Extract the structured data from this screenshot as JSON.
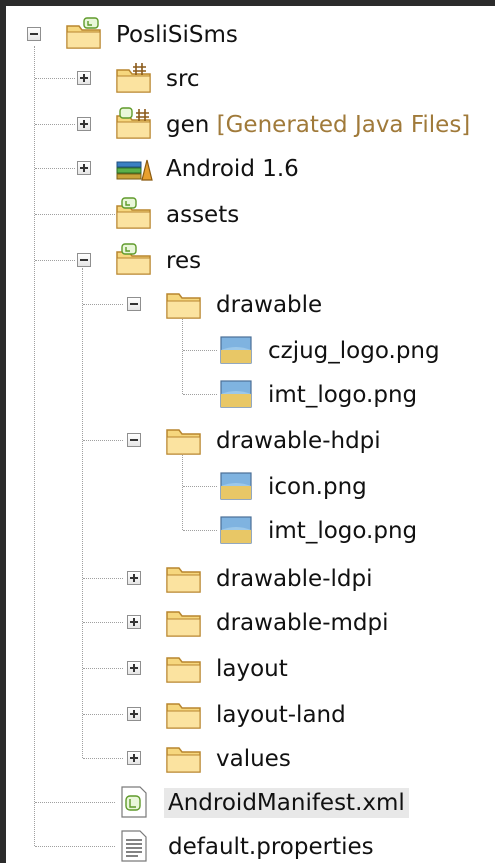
{
  "tree": {
    "project": {
      "label": "PosliSiSms",
      "icon": "android-project-folder-icon"
    },
    "src": {
      "label": "src",
      "icon": "source-folder-icon"
    },
    "gen": {
      "label": "gen",
      "decoration": "[Generated Java Files]",
      "icon": "generated-source-folder-icon"
    },
    "android": {
      "label": "Android 1.6",
      "icon": "android-library-icon"
    },
    "assets": {
      "label": "assets",
      "icon": "android-folder-icon"
    },
    "res": {
      "label": "res",
      "icon": "android-folder-icon"
    },
    "drawable": {
      "label": "drawable",
      "icon": "folder-icon"
    },
    "drawable_czjug": {
      "label": "czjug_logo.png",
      "icon": "image-file-icon"
    },
    "drawable_imt": {
      "label": "imt_logo.png",
      "icon": "image-file-icon"
    },
    "drawable_hdpi": {
      "label": "drawable-hdpi",
      "icon": "folder-icon"
    },
    "hdpi_icon": {
      "label": "icon.png",
      "icon": "image-file-icon"
    },
    "hdpi_imt": {
      "label": "imt_logo.png",
      "icon": "image-file-icon"
    },
    "drawable_ldpi": {
      "label": "drawable-ldpi",
      "icon": "folder-icon"
    },
    "drawable_mdpi": {
      "label": "drawable-mdpi",
      "icon": "folder-icon"
    },
    "layout": {
      "label": "layout",
      "icon": "folder-icon"
    },
    "layout_land": {
      "label": "layout-land",
      "icon": "folder-icon"
    },
    "values": {
      "label": "values",
      "icon": "folder-icon"
    },
    "manifest": {
      "label": "AndroidManifest.xml",
      "icon": "android-manifest-file-icon",
      "selected": true
    },
    "default_props": {
      "label": "default.properties",
      "icon": "text-file-icon"
    }
  },
  "colors": {
    "folder_fill": "#f6d77e",
    "folder_stroke": "#b8862f",
    "android_green": "#7fbf3f",
    "selection_bg": "#e8e8e8",
    "connector": "#a0a0a0"
  }
}
